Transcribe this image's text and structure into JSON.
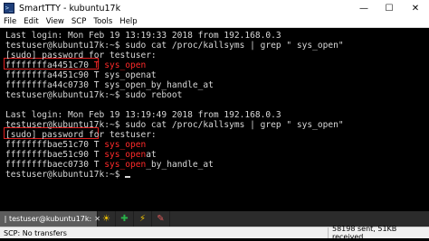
{
  "window": {
    "title": "SmartTTY - kubuntu17k",
    "app_icon": "terminal-icon",
    "minimize": "—",
    "maximize": "☐",
    "close": "✕"
  },
  "menu": [
    "File",
    "Edit",
    "View",
    "SCP",
    "Tools",
    "Help"
  ],
  "terminal": {
    "lines": [
      {
        "parts": [
          {
            "t": "Last login: Mon Feb 19 13:19:33 2018 from 192.168.0.3"
          }
        ]
      },
      {
        "parts": [
          {
            "t": "testuser@kubuntu17k:~$ sudo cat /proc/kallsyms | grep \" sys_open\""
          }
        ]
      },
      {
        "parts": [
          {
            "t": "[sudo] password for testuser:"
          }
        ]
      },
      {
        "parts": [
          {
            "t": "ffffffffa4451c70",
            "red": false
          },
          {
            "t": " "
          },
          {
            "t": "T",
            "red": true
          },
          {
            "t": " "
          },
          {
            "t": "sys_open",
            "red": true
          }
        ]
      },
      {
        "parts": [
          {
            "t": "ffffffffa4451c90 T sys_openat"
          }
        ]
      },
      {
        "parts": [
          {
            "t": "ffffffffa44c0730 T sys_open_by_handle_at"
          }
        ]
      },
      {
        "parts": [
          {
            "t": "testuser@kubuntu17k:~$ sudo reboot"
          }
        ]
      },
      {
        "parts": [
          {
            "t": ""
          }
        ]
      },
      {
        "parts": [
          {
            "t": "Last login: Mon Feb 19 13:19:49 2018 from 192.168.0.3"
          }
        ]
      },
      {
        "parts": [
          {
            "t": "testuser@kubuntu17k:~$ sudo cat /proc/kallsyms | grep \" sys_open\""
          }
        ]
      },
      {
        "parts": [
          {
            "t": "[sudo] password for testuser:"
          }
        ]
      },
      {
        "parts": [
          {
            "t": "ffffffffbae51c70 T "
          },
          {
            "t": "sys_open",
            "red": true
          }
        ]
      },
      {
        "parts": [
          {
            "t": "ffffffffbae51c90 T "
          },
          {
            "t": "sys_open",
            "red": true
          },
          {
            "t": "at"
          }
        ]
      },
      {
        "parts": [
          {
            "t": "ffffffffbaec0730 T "
          },
          {
            "t": "sys_open",
            "red": true
          },
          {
            "t": "_by_handle_at"
          }
        ]
      },
      {
        "parts": [
          {
            "t": "testuser@kubuntu17k:~$ "
          }
        ],
        "cursor": true
      }
    ]
  },
  "tabs": {
    "active_label": "testuser@kubuntu17k:",
    "close": "✕",
    "tools": [
      {
        "name": "sun-icon",
        "glyph": "☀",
        "color": "#f2c300"
      },
      {
        "name": "plus-icon",
        "glyph": "✚",
        "color": "#29b24a"
      },
      {
        "name": "lightning-icon",
        "glyph": "⚡",
        "color": "#f2c300"
      },
      {
        "name": "pencil-icon",
        "glyph": "✎",
        "color": "#e05a5a"
      }
    ]
  },
  "status": {
    "left": "SCP: No transfers",
    "right": "58198 sent, 51KB received"
  }
}
